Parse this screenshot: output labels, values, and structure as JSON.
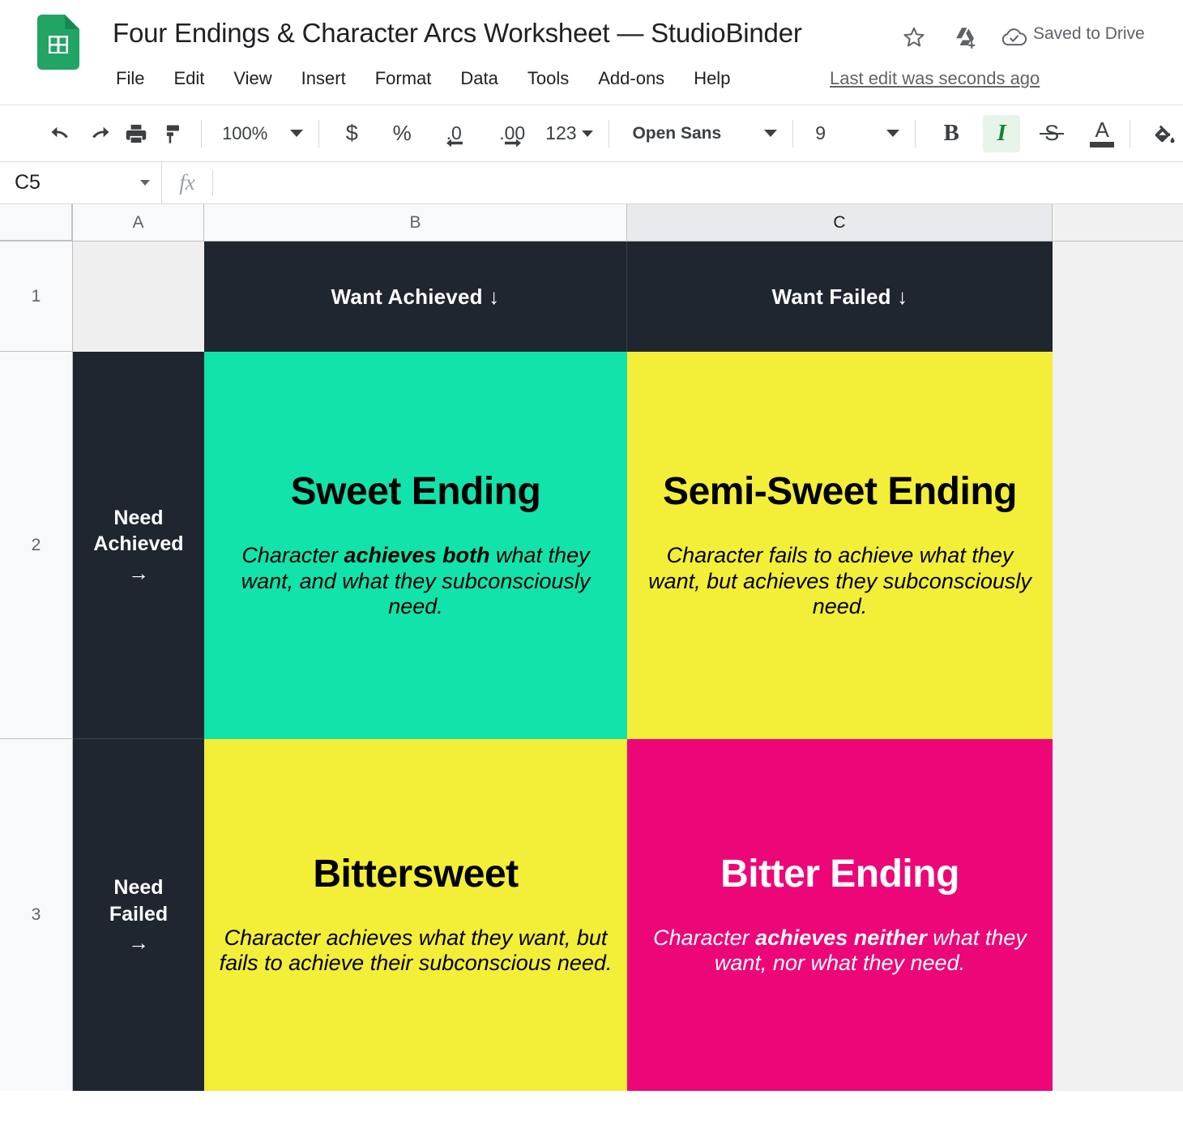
{
  "app": {
    "logo_icon": "google-sheets-icon",
    "doc_title": "Four Endings & Character Arcs Worksheet — StudioBinder",
    "star_icon": "star-outline-icon",
    "move_icon": "move-to-drive-icon",
    "cloud_icon": "cloud-check-icon",
    "saved_status": "Saved to Drive",
    "last_edit": "Last edit was seconds ago"
  },
  "menu": {
    "items": [
      "File",
      "Edit",
      "View",
      "Insert",
      "Format",
      "Data",
      "Tools",
      "Add-ons",
      "Help"
    ]
  },
  "toolbar": {
    "undo": "↶",
    "redo": "↷",
    "print": "print-icon",
    "paint_format": "paint-format-icon",
    "zoom_value": "100%",
    "currency": "$",
    "percent": "%",
    "decrease_decimal": ".0",
    "increase_decimal": ".00",
    "more_formats": "123",
    "font_family": "Open Sans",
    "font_size": "9",
    "bold": "B",
    "italic": "I",
    "strikethrough": "S",
    "text_color": "A",
    "fill_color": "fill-color-icon"
  },
  "formula_bar": {
    "name_box_value": "C5",
    "fx_label": "fx",
    "formula_value": ""
  },
  "grid": {
    "columns": [
      {
        "label": "A",
        "selected": false
      },
      {
        "label": "B",
        "selected": false
      },
      {
        "label": "C",
        "selected": true
      }
    ],
    "rows": [
      "1",
      "2",
      "3"
    ],
    "cells": {
      "a1": "",
      "b1": "Want Achieved ↓",
      "c1": "Want Failed ↓",
      "a2_line1": "Need",
      "a2_line2": "Achieved",
      "a2_arrow": "→",
      "a3_line1": "Need",
      "a3_line2": "Failed",
      "a3_arrow": "→",
      "b2_title": "Sweet Ending",
      "b2_desc_pre": "Character ",
      "b2_desc_bold": "achieves both",
      "b2_desc_post": " what they want, and what they subconsciously need.",
      "c2_title": "Semi-Sweet Ending",
      "c2_desc_pre": "Character fails to achieve what they want, but achieves they subconsciously need.",
      "c2_desc_bold": "",
      "c2_desc_post": "",
      "b3_title": "Bittersweet",
      "b3_desc_pre": "Character achieves what they want, but fails to achieve their subconscious need.",
      "b3_desc_bold": "",
      "b3_desc_post": "",
      "c3_title": "Bitter Ending",
      "c3_desc_pre": "Character ",
      "c3_desc_bold": "achieves neither",
      "c3_desc_post": " what they want, nor what they need."
    }
  },
  "colors": {
    "dark_header": "#1f2630",
    "sweet_teal": "#12e3ab",
    "semi_sweet_yellow": "#f3ee38",
    "bittersweet_yellow": "#f3ee38",
    "bitter_pink": "#ed0677",
    "blank_cell": "#efefef",
    "sheets_green": "#21a464",
    "italic_active_bg": "#e6f4ea",
    "italic_active_fg": "#188038"
  }
}
